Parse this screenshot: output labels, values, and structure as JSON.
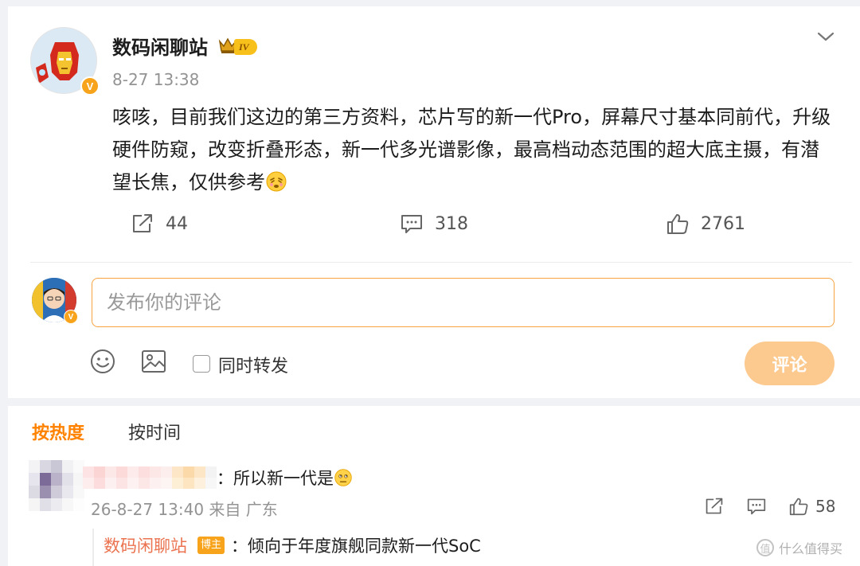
{
  "post": {
    "author": "数码闲聊站",
    "level_badge": "IV",
    "verified_badge": "V",
    "timestamp": "8-27 13:38",
    "content": "咳咳，目前我们这边的第三方资料，芯片写的新一代Pro，屏幕尺寸基本同前代，升级硬件防窥，改变折叠形态，新一代多光谱影像，最高档动态范围的超大底主摄，有潜望长焦，仅供参考",
    "content_emoji_icon": "embarrassed-emoji-icon",
    "repost_count": "44",
    "comment_count": "318",
    "like_count": "2761"
  },
  "composer": {
    "placeholder": "发布你的评论",
    "also_repost_label": "同时转发",
    "submit_label": "评论",
    "user_verified_badge": "V"
  },
  "sort": {
    "hot_label": "按热度",
    "time_label": "按时间"
  },
  "reply": {
    "text": "：所以新一代是",
    "emoji_icon": "confused-emoji-icon",
    "meta": "26-8-27 13:40 来自 广东",
    "like_count": "58",
    "sub_reply": {
      "author": "数码闲聊站",
      "badge": "博主",
      "text": "：倾向于年度旗舰同款新一代SoC"
    }
  },
  "watermark": {
    "symbol": "值",
    "text": "什么值得买"
  },
  "colors": {
    "accent": "#ff8200",
    "input_border": "#f6a341",
    "submit_bg": "#fcc98e",
    "sub_author": "#eb7350",
    "badge_bg": "#f7a31b"
  }
}
